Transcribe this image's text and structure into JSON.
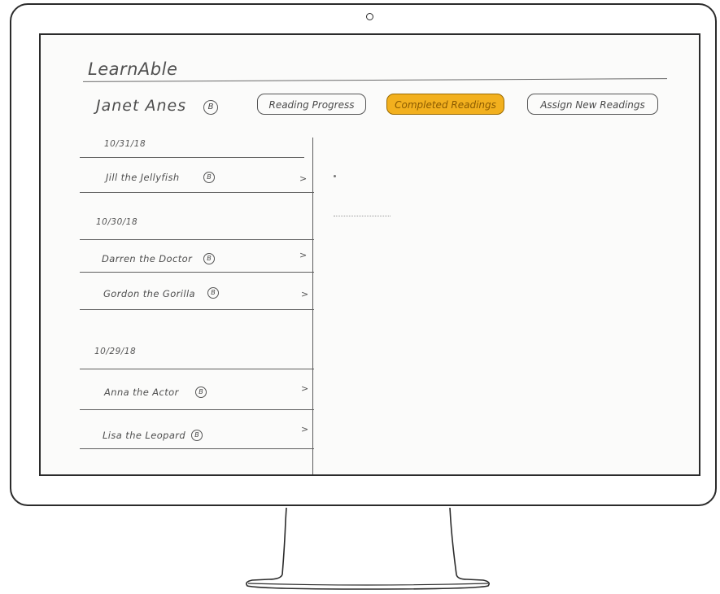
{
  "app": {
    "brand": "LearnAble"
  },
  "header": {
    "student_name": "Janet Anes",
    "student_badge": "B",
    "tabs": [
      {
        "label": "Reading Progress",
        "active": false
      },
      {
        "label": "Completed Readings",
        "active": true
      },
      {
        "label": "Assign New Readings",
        "active": false
      }
    ]
  },
  "colors": {
    "active_tab": "#f2b01e"
  },
  "readings": {
    "groups": [
      {
        "date": "10/31/18",
        "items": [
          {
            "title": "Jill the Jellyfish",
            "badge": "B"
          }
        ]
      },
      {
        "date": "10/30/18",
        "items": [
          {
            "title": "Darren the Doctor",
            "badge": "B"
          },
          {
            "title": "Gordon the Gorilla",
            "badge": "B"
          }
        ]
      },
      {
        "date": "10/29/18",
        "items": [
          {
            "title": "Anna the Actor",
            "badge": "B"
          },
          {
            "title": "Lisa the Leopard",
            "badge": "B"
          }
        ]
      }
    ],
    "chevron": ">"
  }
}
